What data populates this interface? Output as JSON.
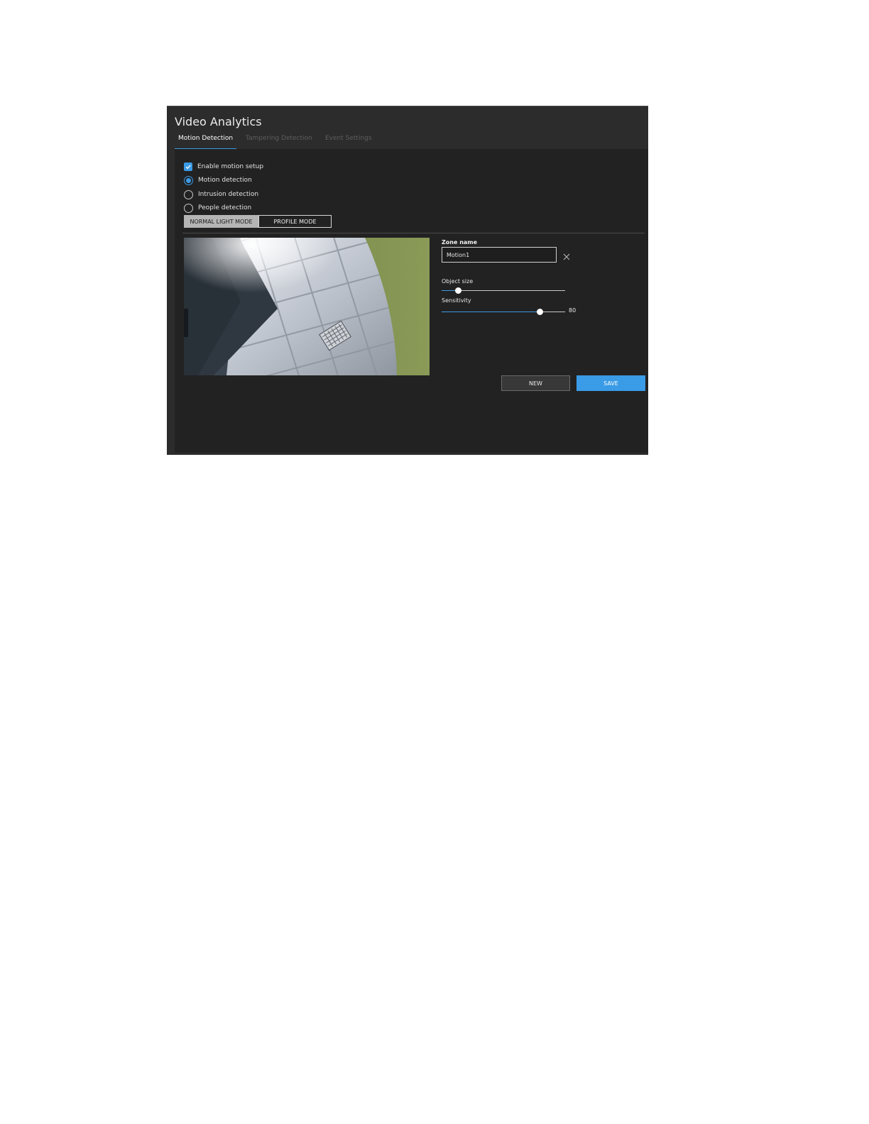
{
  "window": {
    "title": "Video Analytics"
  },
  "tabs": [
    {
      "label": "Motion Detection",
      "active": true
    },
    {
      "label": "Tampering Detection",
      "active": false
    },
    {
      "label": "Event Settings",
      "active": false
    }
  ],
  "options": {
    "enable_motion_setup": {
      "label": "Enable motion setup",
      "checked": true
    },
    "detection_types": [
      {
        "label": "Motion detection",
        "selected": true
      },
      {
        "label": "Intrusion detection",
        "selected": false
      },
      {
        "label": "People detection",
        "selected": false
      }
    ]
  },
  "modes": {
    "normal_light": "NORMAL LIGHT MODE",
    "profile": "PROFILE MODE",
    "active": "normal_light"
  },
  "zone": {
    "label": "Zone name",
    "value": "Motion1",
    "clear_icon": "close-icon"
  },
  "object_size": {
    "label": "Object size",
    "level_fraction": 0.14
  },
  "sensitivity": {
    "label": "Sensitivity",
    "value": "80",
    "level": 80,
    "max": 100
  },
  "buttons": {
    "new": "NEW",
    "save": "SAVE"
  },
  "colors": {
    "accent": "#3a9be6",
    "panel": "#222222",
    "frame": "#2c2c2c"
  }
}
